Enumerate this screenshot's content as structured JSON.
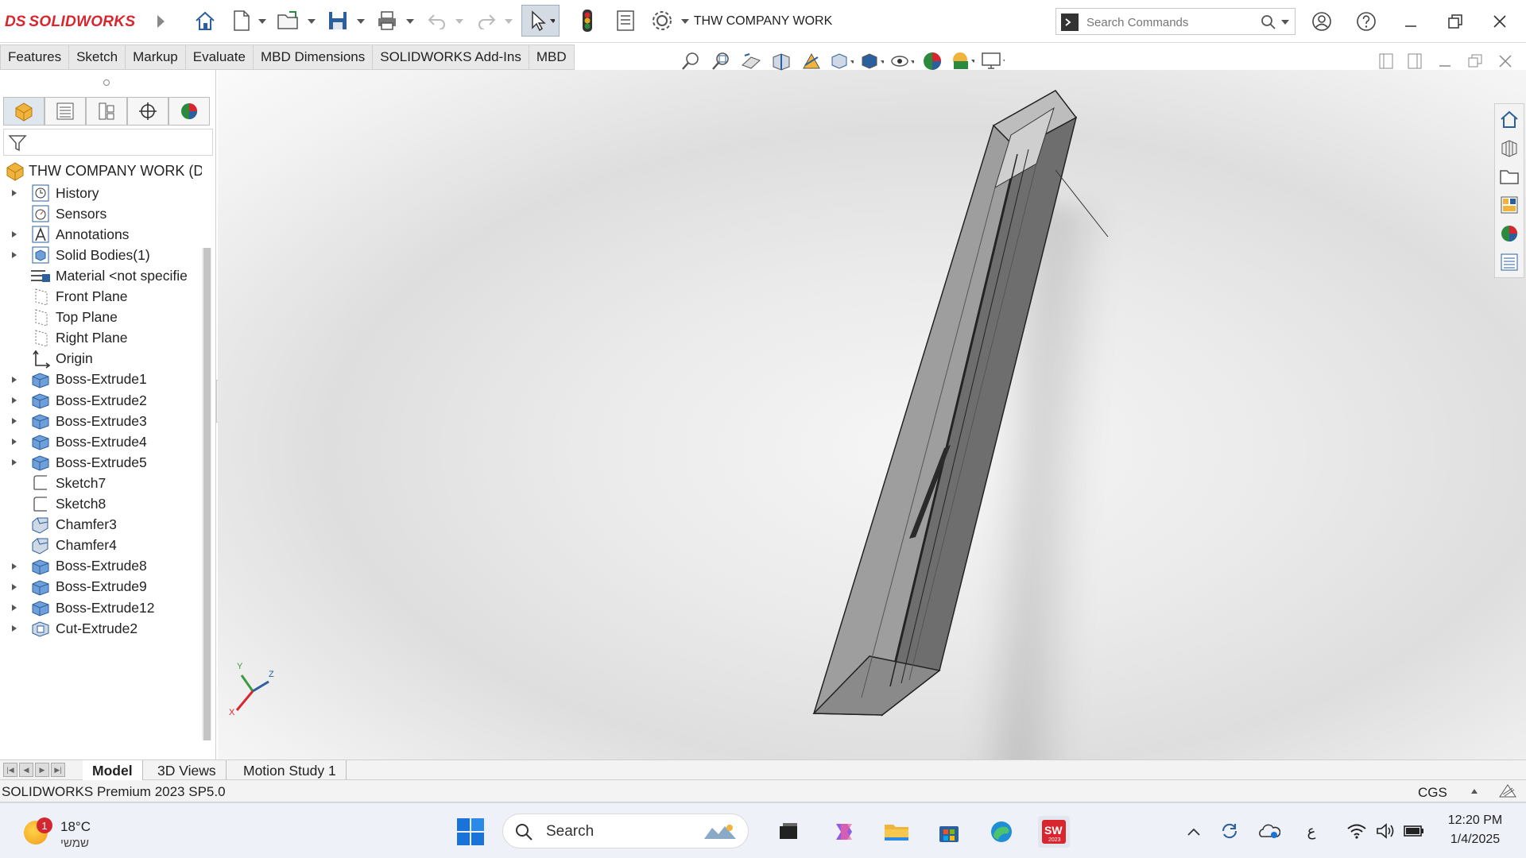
{
  "app": {
    "title": "THW COMPANY WORK",
    "logo_ds": "DS",
    "logo_name": "SOLIDWORKS",
    "search_placeholder": "Search Commands"
  },
  "command_tabs": [
    "Features",
    "Sketch",
    "Markup",
    "Evaluate",
    "MBD Dimensions",
    "SOLIDWORKS Add-Ins",
    "MBD"
  ],
  "feature_tree": {
    "root": "THW COMPANY WORK (D",
    "items": [
      {
        "label": "History",
        "icon": "history-icon",
        "expand": true
      },
      {
        "label": "Sensors",
        "icon": "sensor-icon",
        "expand": false
      },
      {
        "label": "Annotations",
        "icon": "annotation-icon",
        "expand": true
      },
      {
        "label": "Solid Bodies(1)",
        "icon": "solid-body-icon",
        "expand": true
      },
      {
        "label": "Material <not specifie",
        "icon": "material-icon",
        "expand": false
      },
      {
        "label": "Front Plane",
        "icon": "plane-icon",
        "expand": false
      },
      {
        "label": "Top Plane",
        "icon": "plane-icon",
        "expand": false
      },
      {
        "label": "Right Plane",
        "icon": "plane-icon",
        "expand": false
      },
      {
        "label": "Origin",
        "icon": "origin-icon",
        "expand": false
      },
      {
        "label": "Boss-Extrude1",
        "icon": "extrude-icon",
        "expand": true
      },
      {
        "label": "Boss-Extrude2",
        "icon": "extrude-icon",
        "expand": true
      },
      {
        "label": "Boss-Extrude3",
        "icon": "extrude-icon",
        "expand": true
      },
      {
        "label": "Boss-Extrude4",
        "icon": "extrude-icon",
        "expand": true
      },
      {
        "label": "Boss-Extrude5",
        "icon": "extrude-icon",
        "expand": true
      },
      {
        "label": "Sketch7",
        "icon": "sketch-icon",
        "expand": false
      },
      {
        "label": "Sketch8",
        "icon": "sketch-icon",
        "expand": false
      },
      {
        "label": "Chamfer3",
        "icon": "chamfer-icon",
        "expand": false
      },
      {
        "label": "Chamfer4",
        "icon": "chamfer-icon",
        "expand": false
      },
      {
        "label": "Boss-Extrude8",
        "icon": "extrude-icon",
        "expand": true
      },
      {
        "label": "Boss-Extrude9",
        "icon": "extrude-icon",
        "expand": true
      },
      {
        "label": "Boss-Extrude12",
        "icon": "extrude-icon",
        "expand": true
      },
      {
        "label": "Cut-Extrude2",
        "icon": "cut-extrude-icon",
        "expand": true
      }
    ]
  },
  "triad": {
    "x": "X",
    "y": "Y",
    "z": "Z"
  },
  "bottom_tabs": [
    "Model",
    "3D Views",
    "Motion Study 1"
  ],
  "status": {
    "product": "SOLIDWORKS Premium 2023 SP5.0",
    "units": "CGS"
  },
  "taskbar": {
    "weather_temp": "18°C",
    "weather_cond": "שמשי",
    "weather_badge": "1",
    "search_label": "Search",
    "swlogo": "SW",
    "swyear": "2023",
    "lang": "ع",
    "time": "12:20 PM",
    "date": "1/4/2025"
  }
}
